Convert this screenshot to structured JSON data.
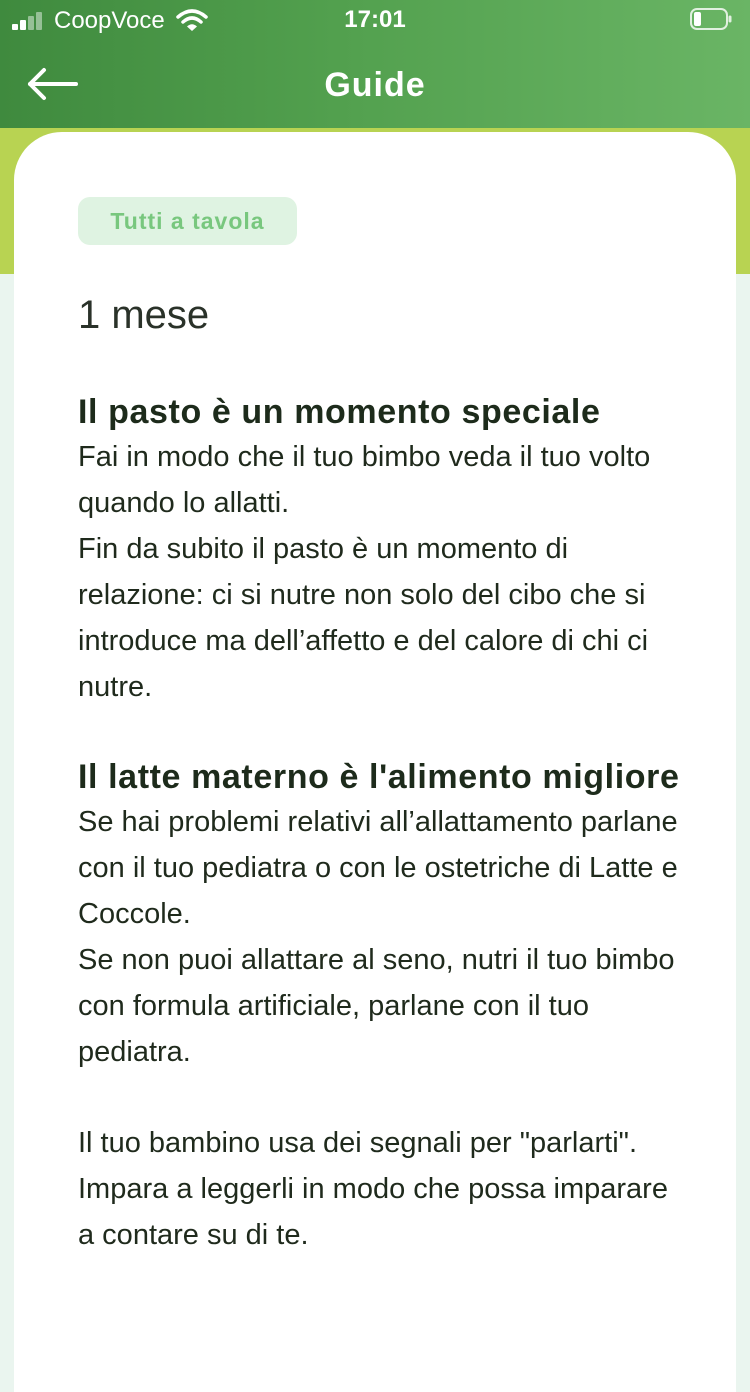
{
  "status_bar": {
    "carrier": "CoopVoce",
    "time": "17:01"
  },
  "header": {
    "title": "Guide"
  },
  "icons": {
    "back": "arrow-left-icon",
    "signal": "signal-icon",
    "wifi": "wifi-icon",
    "battery": "battery-icon"
  },
  "colors": {
    "header_start": "#3f8a3e",
    "header_end": "#6ab565",
    "band": "#b8d352",
    "chip_bg": "#dff3e2",
    "chip_text": "#78c77e"
  },
  "card": {
    "tag": "Tutti a tavola",
    "age": "1 mese",
    "sections": [
      {
        "title": "Il pasto è un momento speciale",
        "paragraphs": [
          "Fai in modo che il tuo bimbo veda il tuo volto quando lo allatti.",
          "Fin da subito il pasto è un momento di relazione: ci si nutre non solo del cibo che si introduce ma dell’affetto e del calore di chi ci nutre."
        ]
      },
      {
        "title": "Il latte materno è l'alimento migliore",
        "paragraphs": [
          "Se hai problemi relativi all’allattamento parlane con il tuo pediatra o con le ostetriche di Latte e Coccole.",
          "Se non puoi allattare al seno, nutri il tuo bimbo con formula artificiale, parlane con il tuo pediatra."
        ]
      }
    ],
    "closing": "Il tuo bambino usa dei segnali per \"parlarti\". Impara a leggerli in modo che possa imparare a contare su di te."
  }
}
